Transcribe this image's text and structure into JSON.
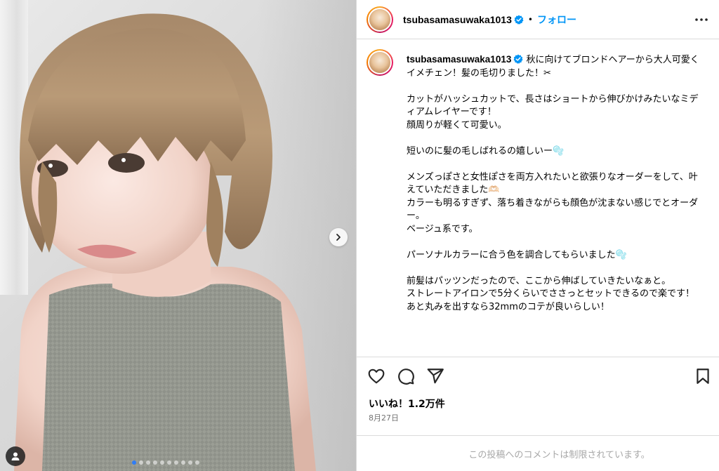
{
  "post": {
    "username": "tsubasamasuwaka1013",
    "follow_label": "フォロー",
    "separator": "•",
    "caption_text": " 秋に向けてブロンドヘアーから大人可愛くイメチェン！髪の毛切りました！✂︎\n\nカットがハッシュカットで、長さはショートから伸びかけみたいなミディアムレイヤーです！\n顔周りが軽くて可愛い。\n\n短いのに髪の毛しばれるの嬉しいー🫧\n\nメンズっぽさと女性ぽさを両方入れたいと欲張りなオーダーをして、叶えていただきました🫶🏻\nカラーも明るすぎず、落ち着きながらも顔色が沈まない感じでとオーダー。\nベージュ系です。\n\nパーソナルカラーに合う色を調合してもらいました🫧\n\n前髪はパッツンだったので、ここから伸ばしていきたいなぁと。\nストレートアイロンで5分くらいでささっとセットできるので楽です！\nあと丸みを出すなら32mmのコテが良いらしい！",
    "likes": "いいね！1.2万件",
    "date": "8月27日",
    "comments_restricted": "この投稿へのコメントは制限されています。"
  },
  "carousel": {
    "total": 10,
    "active_index": 0
  },
  "icons": {
    "verified": "verified-badge-icon",
    "more": "more-options-icon",
    "like": "heart-icon",
    "comment": "comment-bubble-icon",
    "share": "paper-plane-icon",
    "save": "bookmark-icon",
    "next": "chevron-right-icon",
    "tags": "user-tag-icon"
  },
  "colors": {
    "accent": "#0095f6",
    "verified": "#0095f6",
    "muted": "#737373",
    "border": "#dbdbdb"
  }
}
